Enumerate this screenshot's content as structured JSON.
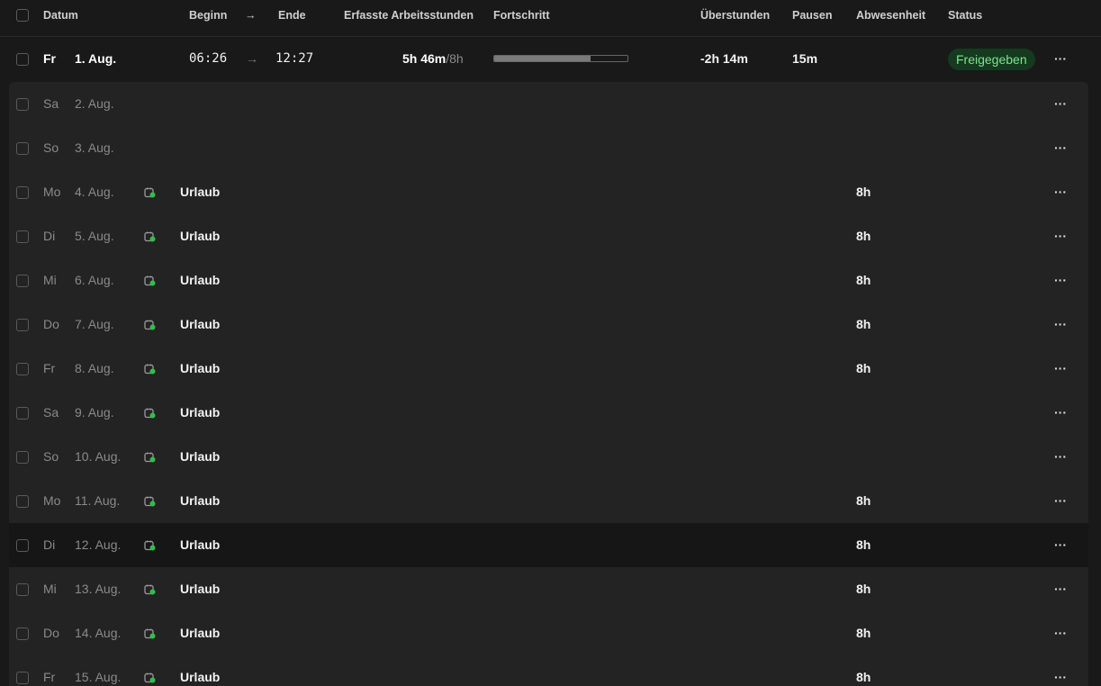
{
  "header": {
    "datum": "Datum",
    "beginn": "Beginn",
    "arrow": "→",
    "ende": "Ende",
    "erfasste": "Erfasste Arbeitsstunden",
    "fortschritt": "Fortschritt",
    "ueberstunden": "Überstunden",
    "pausen": "Pausen",
    "abwesenheit": "Abwesenheit",
    "status": "Status"
  },
  "first_row": {
    "day": "Fr",
    "date": "1. Aug.",
    "start": "06:26",
    "arrow": "→",
    "end": "12:27",
    "hours": "5h 46m",
    "target": "/8h",
    "progress": 0.72,
    "overtime": "-2h 14m",
    "pause": "15m",
    "status": "Freigegeben",
    "menu": "···"
  },
  "rows": [
    {
      "day": "Sa",
      "date": "2. Aug.",
      "type": "",
      "absence": "",
      "menu": "···"
    },
    {
      "day": "So",
      "date": "3. Aug.",
      "type": "",
      "absence": "",
      "menu": "···"
    },
    {
      "day": "Mo",
      "date": "4. Aug.",
      "type": "Urlaub",
      "absence": "8h",
      "menu": "···"
    },
    {
      "day": "Di",
      "date": "5. Aug.",
      "type": "Urlaub",
      "absence": "8h",
      "menu": "···"
    },
    {
      "day": "Mi",
      "date": "6. Aug.",
      "type": "Urlaub",
      "absence": "8h",
      "menu": "···"
    },
    {
      "day": "Do",
      "date": "7. Aug.",
      "type": "Urlaub",
      "absence": "8h",
      "menu": "···"
    },
    {
      "day": "Fr",
      "date": "8. Aug.",
      "type": "Urlaub",
      "absence": "8h",
      "menu": "···"
    },
    {
      "day": "Sa",
      "date": "9. Aug.",
      "type": "Urlaub",
      "absence": "",
      "menu": "···"
    },
    {
      "day": "So",
      "date": "10. Aug.",
      "type": "Urlaub",
      "absence": "",
      "menu": "···"
    },
    {
      "day": "Mo",
      "date": "11. Aug.",
      "type": "Urlaub",
      "absence": "8h",
      "menu": "···"
    },
    {
      "day": "Di",
      "date": "12. Aug.",
      "type": "Urlaub",
      "absence": "8h",
      "menu": "···"
    },
    {
      "day": "Mi",
      "date": "13. Aug.",
      "type": "Urlaub",
      "absence": "8h",
      "menu": "···"
    },
    {
      "day": "Do",
      "date": "14. Aug.",
      "type": "Urlaub",
      "absence": "8h",
      "menu": "···"
    },
    {
      "day": "Fr",
      "date": "15. Aug.",
      "type": "Urlaub",
      "absence": "8h",
      "menu": "···"
    }
  ],
  "colors": {
    "accent": "#2fbf4a",
    "badge_bg": "#153a1f",
    "badge_text": "#7de38e"
  },
  "icons": {
    "vacation": "calendar-check-icon",
    "menu": "more-horizontal-icon"
  }
}
